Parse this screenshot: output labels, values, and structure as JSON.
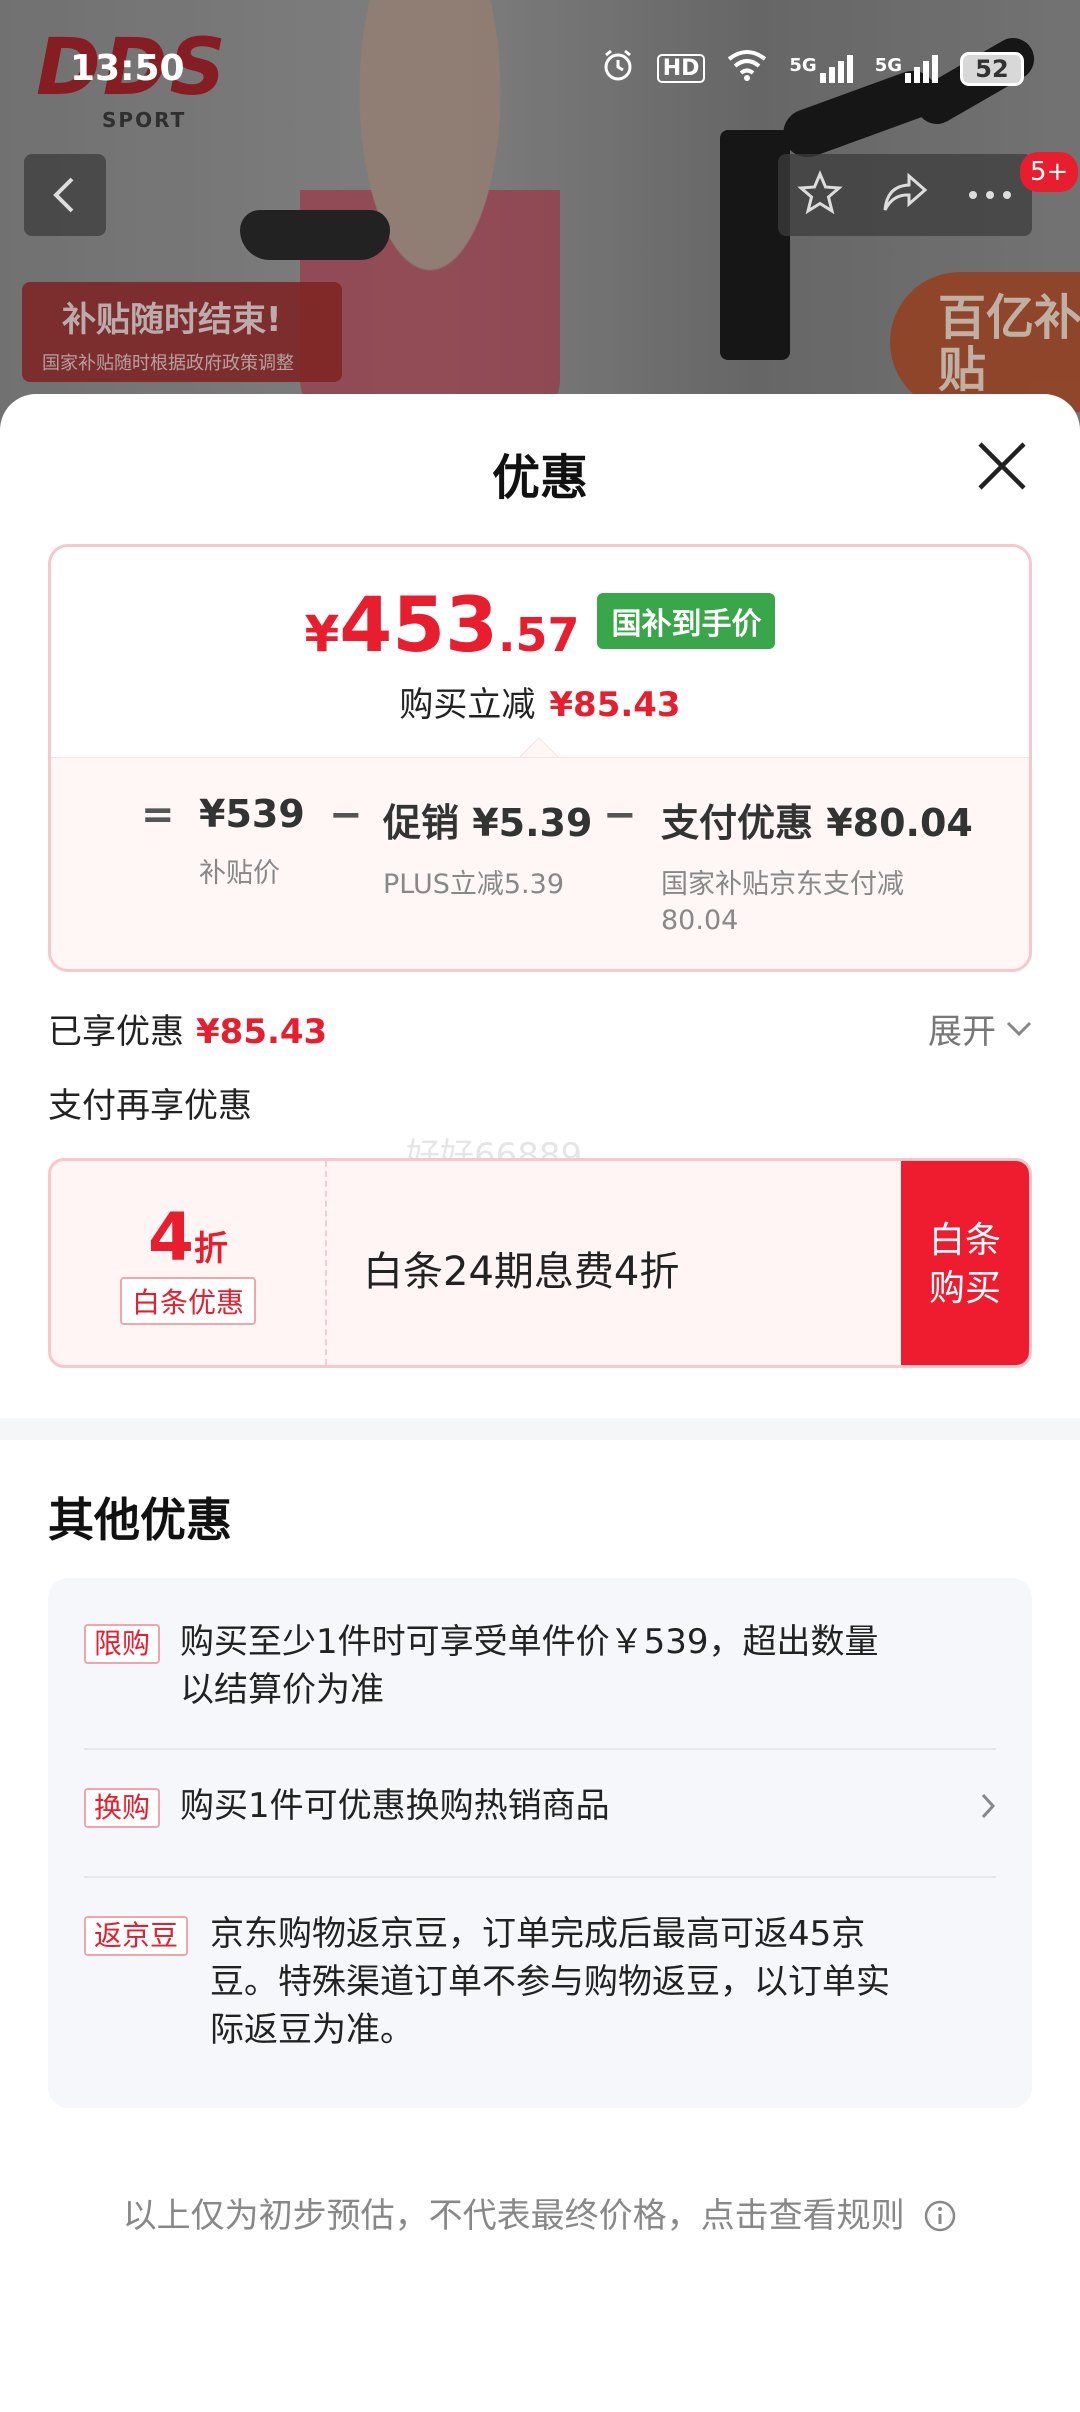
{
  "status_bar": {
    "time": "13:50",
    "hd": "HD",
    "net1": "5G",
    "net2": "5G",
    "battery": "52"
  },
  "background": {
    "brand_logo": "DDS",
    "brand_sub": "SPORT",
    "promo_left_title": "补贴随时结束!",
    "promo_left_sub": "国家补贴随时根据政府政策调整",
    "promo_right": "百亿补贴",
    "message_badge": "5+"
  },
  "sheet": {
    "title": "优惠",
    "price": {
      "currency": "¥",
      "integer": "453",
      "decimal": ".57",
      "tag": "国补到手价"
    },
    "reduce_label": "购买立减",
    "reduce_amount": "¥85.43",
    "formula": {
      "eq": "=",
      "base_value": "¥539",
      "base_label": "补贴价",
      "minus1": "−",
      "promo_value": "促销 ¥5.39",
      "promo_label": "PLUS立减5.39",
      "minus2": "−",
      "pay_value": "支付优惠 ¥80.04",
      "pay_label": "国家补贴京东支付减80.04"
    },
    "enjoyed_label": "已享优惠",
    "enjoyed_amount": "¥85.43",
    "expand_label": "展开",
    "pay_more_label": "支付再享优惠",
    "watermark": "好好66889",
    "coupon": {
      "discount_num": "4",
      "discount_unit": "折",
      "tag": "白条优惠",
      "desc": "白条24期息费4折",
      "button_line1": "白条",
      "button_line2": "购买"
    },
    "other_title": "其他优惠",
    "other_items": [
      {
        "tag": "限购",
        "desc": "购买至少1件时可享受单件价￥539，超出数量以结算价为准"
      },
      {
        "tag": "换购",
        "desc": "购买1件可优惠换购热销商品"
      },
      {
        "tag": "返京豆",
        "desc": "京东购物返京豆，订单完成后最高可返45京豆。特殊渠道订单不参与购物返豆，以订单实际返豆为准。"
      }
    ],
    "footnote": "以上仅为初步预估，不代表最终价格，点击查看规则"
  },
  "colors": {
    "accent_red": "#e81d2e",
    "green_tag": "#3aa64a",
    "card_border": "#f6c7cc"
  }
}
